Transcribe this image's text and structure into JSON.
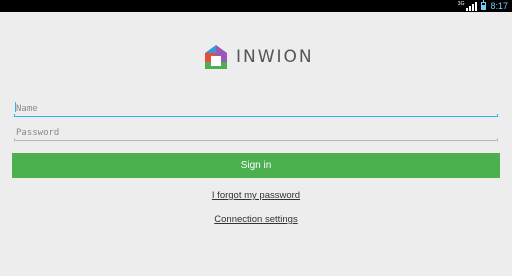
{
  "status_bar": {
    "network_label": "3G",
    "time": "8:17",
    "accent_color": "#7ecbf2"
  },
  "brand": {
    "name": "INWION",
    "icon": "house-logo-icon",
    "logo_colors": [
      "#9b59b6",
      "#e74c3c",
      "#4caf50",
      "#3498db"
    ]
  },
  "form": {
    "name_placeholder": "Name",
    "password_placeholder": "Password",
    "sign_in_label": "Sign in",
    "focus_color": "#33b5e5",
    "button_color": "#4caf50"
  },
  "links": {
    "forgot_password": "I forgot my password",
    "connection_settings": "Connection settings"
  }
}
